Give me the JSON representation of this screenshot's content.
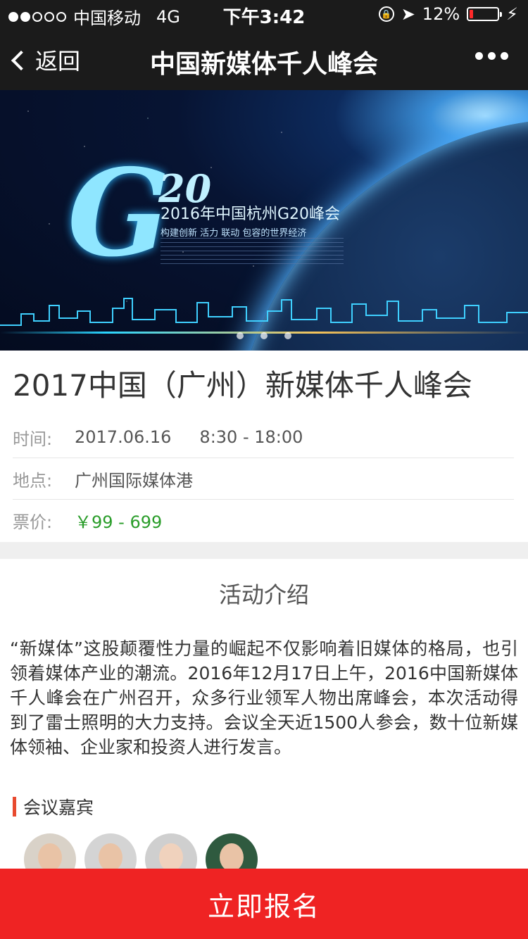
{
  "status_bar": {
    "carrier": "中国移动",
    "network": "4G",
    "time": "下午3:42",
    "battery_text": "12%",
    "battery_level": 0.12
  },
  "nav": {
    "back_label": "返回",
    "title": "中国新媒体千人峰会"
  },
  "banner": {
    "logo_letter": "G",
    "logo_number": "20",
    "headline": "2016年中国杭州G20峰会",
    "slogan": "构建创新  活力  联动  包容的世界经济",
    "page_count": 3
  },
  "event": {
    "title": "2017中国（广州）新媒体千人峰会",
    "time_label": "时间:",
    "date": "2017.06.16",
    "hours": "8:30 - 18:00",
    "place_label": "地点:",
    "place": "广州国际媒体港",
    "price_label": "票价:",
    "price": "￥99 - 699",
    "price_color": "#2a9d2a"
  },
  "intro": {
    "heading": "活动介绍",
    "text": "“新媒体”这股颠覆性力量的崛起不仅影响着旧媒体的格局，也引领着媒体产业的潮流。2016年12月17日上午，2016中国新媒体千人峰会在广州召开，众多行业领军人物出席峰会，本次活动得到了雷士照明的大力支持。会议全天近1500人参会，数十位新媒体领袖、企业家和投资人进行发言。"
  },
  "guests": {
    "heading": "会议嘉宾",
    "accent_color": "#e84a2f",
    "count": 4
  },
  "footer": {
    "signup_label": "立即报名",
    "button_color": "#ef2323"
  }
}
